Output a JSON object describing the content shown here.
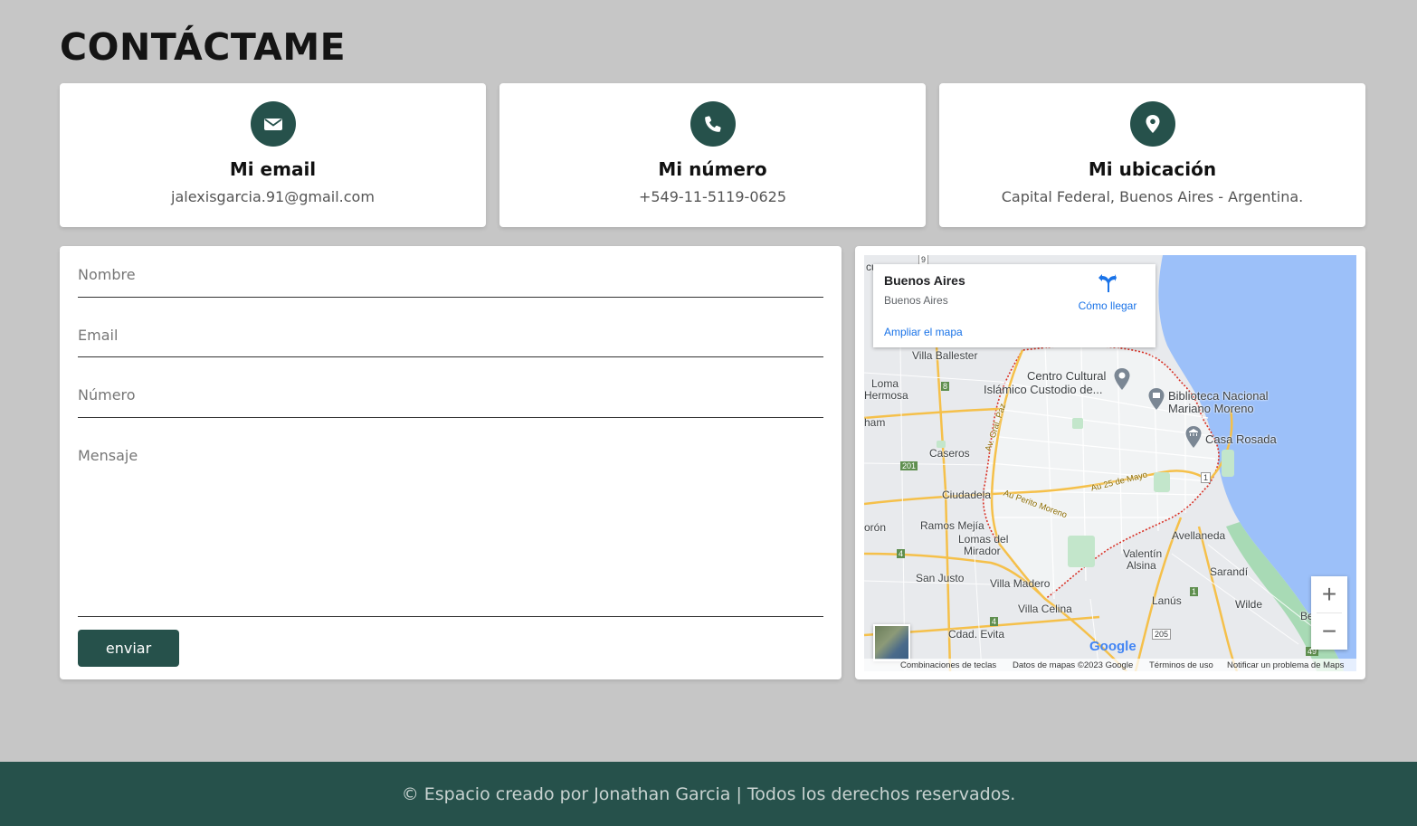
{
  "page_title": "CONTÁCTAME",
  "cards": [
    {
      "icon": "envelope-icon",
      "title": "Mi email",
      "value": "jalexisgarcia.91@gmail.com"
    },
    {
      "icon": "phone-icon",
      "title": "Mi número",
      "value": "+549-11-5119-0625"
    },
    {
      "icon": "map-marker-icon",
      "title": "Mi ubicación",
      "value": "Capital Federal, Buenos Aires - Argentina."
    }
  ],
  "form": {
    "name_placeholder": "Nombre",
    "email_placeholder": "Email",
    "number_placeholder": "Número",
    "message_placeholder": "Mensaje",
    "submit_label": "enviar"
  },
  "map": {
    "place_title": "Buenos Aires",
    "place_subtitle": "Buenos Aires",
    "directions_label": "Cómo llegar",
    "enlarge_link": "Ampliar el mapa",
    "zoom_in": "+",
    "zoom_out": "−",
    "google_logo": "Google",
    "attribution": {
      "shortcuts": "Combinaciones de teclas",
      "data": "Datos de mapas ©2023 Google",
      "terms": "Términos de uso",
      "report": "Notificar un problema de Maps"
    },
    "places": {
      "villa_ballester": "Villa Ballester",
      "centro_cultural_1": "Centro Cultural",
      "centro_cultural_2": "Islámico Custodio de...",
      "loma_1": "Loma",
      "loma_2": "Hermosa",
      "biblioteca_1": "Biblioteca Nacional",
      "biblioteca_2": "Mariano Moreno",
      "casa_rosada": "Casa Rosada",
      "caseros": "Caseros",
      "ciudadela": "Ciudadela",
      "ramos_mejia": "Ramos Mejía",
      "lomas_1": "Lomas del",
      "lomas_2": "Mirador",
      "avellaneda": "Avellaneda",
      "valentin_1": "Valentín",
      "valentin_2": "Alsina",
      "sarandi": "Sarandí",
      "san_justo": "San Justo",
      "villa_madero": "Villa Madero",
      "lanus": "Lanús",
      "wilde": "Wilde",
      "villa_celina": "Villa Celina",
      "cdad_evita": "Cdad. Evita",
      "au_25_mayo": "Au 25 de Mayo",
      "au_perito_moreno": "Au Perito Moreno",
      "av_gral_paz": "Av. Gral. Paz",
      "ham": "ham",
      "moron": "orón",
      "be": "Be",
      "cu": "cu"
    },
    "route_shields": [
      "9",
      "8",
      "201",
      "1",
      "4",
      "4",
      "205",
      "1",
      "49"
    ]
  },
  "footer_text": "© Espacio creado por Jonathan Garcia | Todos los derechos reservados.",
  "colors": {
    "accent": "#26514b",
    "background": "#c6c6c6",
    "card": "#ffffff",
    "water": "#9cc0f9"
  }
}
